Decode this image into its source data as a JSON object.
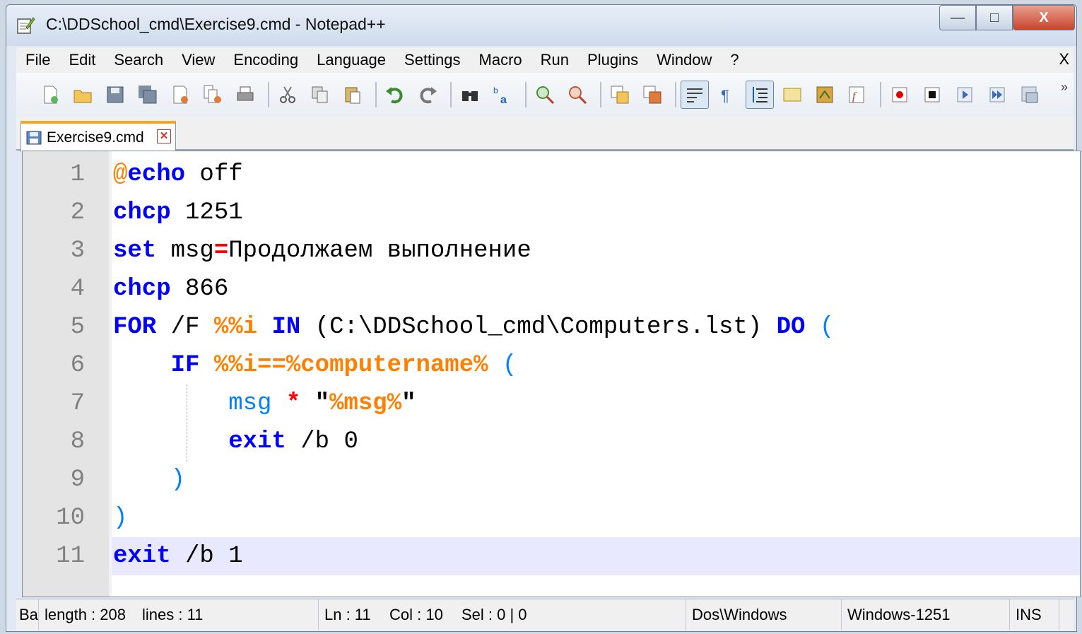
{
  "window": {
    "title": "C:\\DDSchool_cmd\\Exercise9.cmd - Notepad++",
    "minimize": "—",
    "maximize": "□",
    "close": "X"
  },
  "menu": {
    "items": [
      "File",
      "Edit",
      "Search",
      "View",
      "Encoding",
      "Language",
      "Settings",
      "Macro",
      "Run",
      "Plugins",
      "Window",
      "?"
    ],
    "close_label": "X"
  },
  "toolbar": {
    "more": "»",
    "buttons": [
      "new-file-icon",
      "open-file-icon",
      "save-icon",
      "save-all-icon",
      "close-icon",
      "close-all-icon",
      "print-icon",
      "cut-icon",
      "copy-icon",
      "paste-icon",
      "undo-icon",
      "redo-icon",
      "find-icon",
      "replace-icon",
      "zoom-in-icon",
      "zoom-out-icon",
      "sync-vertical-icon",
      "sync-horizontal-icon",
      "word-wrap-icon",
      "show-all-chars-icon",
      "indent-guide-icon",
      "user-defined-lang-icon",
      "doc-map-icon",
      "function-list-icon",
      "record-macro-icon",
      "stop-record-icon",
      "play-macro-icon",
      "run-macro-multiple-icon",
      "save-macro-icon"
    ]
  },
  "tab": {
    "label": "Exercise9.cmd",
    "close": "✕"
  },
  "editor": {
    "line_numbers": [
      "1",
      "2",
      "3",
      "4",
      "5",
      "6",
      "7",
      "8",
      "9",
      "10",
      "11"
    ],
    "lines": {
      "l1": {
        "at": "@",
        "kw": "echo",
        "rest": " off"
      },
      "l2": {
        "kw": "chcp",
        "rest": " 1251"
      },
      "l3": {
        "kw": "set",
        "a": " msg",
        "op": "=",
        "rest": "Продолжаем выполнение"
      },
      "l4": {
        "kw": "chcp",
        "rest": " 866"
      },
      "l5": {
        "kw": "FOR",
        "a": " /F ",
        "var": "%%i",
        "sp": " ",
        "kw2": "IN",
        "b": " (C:\\DDSchool_cmd\\Computers.lst) ",
        "kw3": "DO",
        "sp2": " ",
        "paren": "("
      },
      "l6": {
        "indent": "    ",
        "kw": "IF",
        "sp": " ",
        "var": "%%i==%computername%",
        "sp2": " ",
        "paren": "("
      },
      "l7": {
        "indent": "        ",
        "cmd": "msg",
        "sp": " ",
        "op": "*",
        "sp2": " ",
        "q1": "\"",
        "var": "%msg%",
        "q2": "\""
      },
      "l8": {
        "indent": "        ",
        "kw": "exit",
        "rest": " /b 0"
      },
      "l9": {
        "indent": "    ",
        "paren": ")"
      },
      "l10": {
        "paren": ")"
      },
      "l11": {
        "kw": "exit",
        "rest": " /b 1"
      }
    }
  },
  "status": {
    "lang": "Ba",
    "length": "length : 208",
    "lines": "lines : 11",
    "ln": "Ln : 11",
    "col": "Col : 10",
    "sel": "Sel : 0 | 0",
    "eol": "Dos\\Windows",
    "encoding": "Windows-1251",
    "mode": "INS"
  },
  "colors": {
    "keyword": "#0000ff",
    "variable": "#ff8000",
    "paren": "#0080ff",
    "operator": "#ff0000",
    "current_line": "#e8e8ff",
    "gutter": "#e4e4e4"
  }
}
